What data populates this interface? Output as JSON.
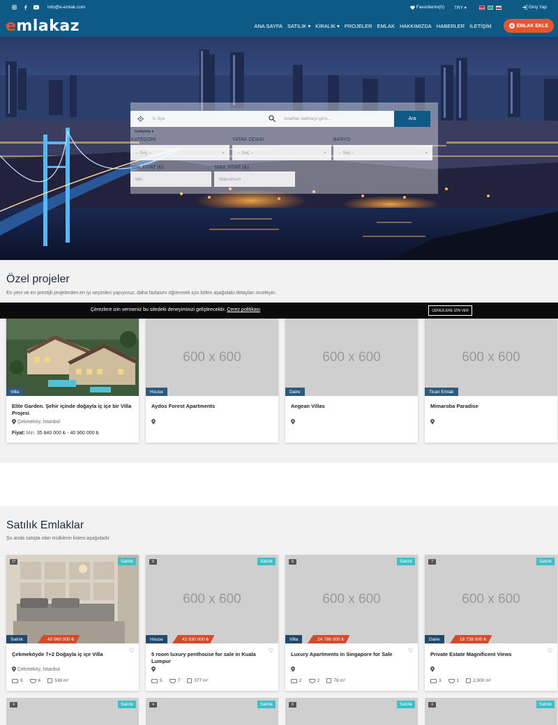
{
  "topbar": {
    "email": "info@e-emlak.com",
    "favorites": "Favorilerim(0)",
    "currency": "TRY",
    "login": "Giriş Yap",
    "social_icons": [
      "instagram-icon",
      "facebook-icon",
      "youtube-icon"
    ]
  },
  "nav": {
    "logo_e": "e",
    "logo_rest": "mlakaz",
    "items": [
      "ANA SAYFA",
      "SATILIK",
      "KİRALIK",
      "PROJELER",
      "EMLAK",
      "HAKKIMIZDA",
      "HABERLER",
      "İLETİŞİM"
    ],
    "add_button": "EMLAK EKLE"
  },
  "search": {
    "location_placeholder": "İl, İlçe",
    "keyword_placeholder": "Anahtar kelimeyi girin...",
    "button": "Ara",
    "advanced": "Gelişmiş",
    "category_label": "KATEGORİ",
    "bedroom_label": "YATAK ODASI",
    "bathroom_label": "BANYO",
    "select_placeholder": "-- Seç --",
    "min_price_label": "MİN. FİYAT (₺)",
    "max_price_label": "MAX. FİYAT (₺)",
    "min_placeholder": "Min.",
    "max_placeholder": "Maksimum"
  },
  "cookie": {
    "message": "Çerezlere izin vermeniz bu sitedeki deneyiminizi geliştirecektir.",
    "link": "Çerez politikası",
    "button": "ÇEREZLERE İZİN VER"
  },
  "projects": {
    "title": "Özel projeler",
    "subtitle": "En yeni ve en prestijli projelerden en iyi seçimleri yapıyoruz, daha fazlasını öğrenmek için lütfen aşağıdaki detayları inceleyin.",
    "placeholder": "600 x 600",
    "price_label": "Fiyat:",
    "price_min": "Min.",
    "price_range": "35 840 000 ₺ - 40 960 000 ₺",
    "cards": [
      {
        "tag": "Villa",
        "title": "Elite Garden. Şehir içinde doğayla iç içe bir Villa Projesi",
        "location": "Çekmeköy, İstanbul"
      },
      {
        "tag": "House",
        "title": "Aydos Forest Apartments",
        "location": ""
      },
      {
        "tag": "Daire",
        "title": "Aegean Villas",
        "location": ""
      },
      {
        "tag": "Ticari Emlak",
        "title": "Mimaroba Paradise",
        "location": ""
      }
    ]
  },
  "listings": {
    "title": "Satılık Emlaklar",
    "subtitle": "Şu anda satışta olan mülklerin listesi aşağıdadır",
    "badge": "Satılık",
    "placeholder": "600 x 600",
    "cards": [
      {
        "photos": "17",
        "type": "Satılık",
        "price": "40 960 000 ₺",
        "title": "Çekmeköyde 7+2 Doğayla iç içe Villa",
        "location": "Çekmeköy, İstanbul",
        "beds": "9",
        "baths": "6",
        "area": "538 m²"
      },
      {
        "photos": "6",
        "type": "House",
        "price": "42 930 000 ₺",
        "title": "5 room luxury penthouse for sale in Kuala Lumpur",
        "location": "",
        "beds": "5",
        "baths": "7",
        "area": "377 m²"
      },
      {
        "photos": "6",
        "type": "Villa",
        "price": "24 786 000 ₺",
        "title": "Luxury Apartments in Singapore for Sale",
        "location": "",
        "beds": "2",
        "baths": "2",
        "area": "78 m²"
      },
      {
        "photos": "7",
        "type": "Daire",
        "price": "18 738 000 ₺",
        "title": "Private Estate Magnificent Views",
        "location": "",
        "beds": "3",
        "baths": "1",
        "area": "2,000 m²"
      }
    ],
    "row2_photos": [
      "4",
      "4",
      "6",
      "4"
    ]
  },
  "colors": {
    "primary": "#0c5a85",
    "accent": "#e9552a",
    "teal": "#3bbfc8"
  }
}
